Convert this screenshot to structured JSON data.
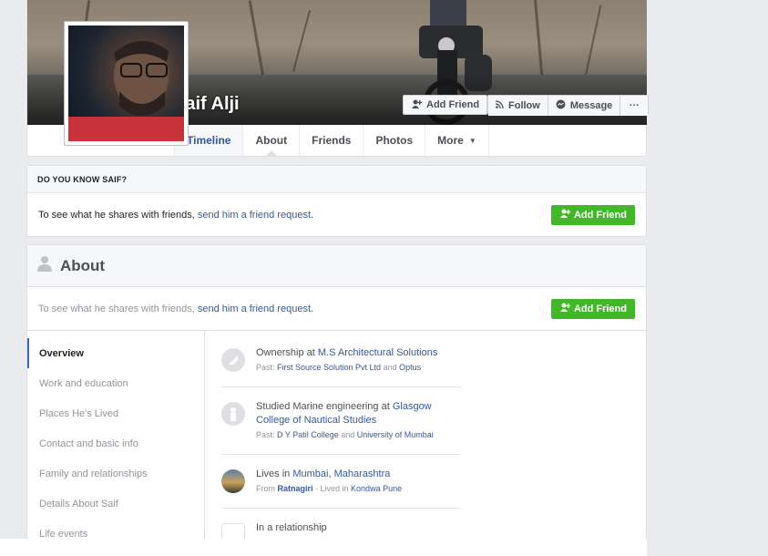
{
  "profile": {
    "name": "Saif Alji",
    "buttons": {
      "add_friend": "Add Friend",
      "follow": "Follow",
      "message": "Message",
      "more_dots": "···"
    }
  },
  "tabs": [
    {
      "label": "Timeline"
    },
    {
      "label": "About"
    },
    {
      "label": "Friends"
    },
    {
      "label": "Photos"
    },
    {
      "label": "More"
    }
  ],
  "know_card": {
    "heading": "DO YOU KNOW SAIF?",
    "text_before": "To see what he shares with friends, ",
    "link": "send him a friend request.",
    "button": "Add Friend"
  },
  "about": {
    "title": "About",
    "share_before": "To see what he shares with friends, ",
    "share_link": "send him a friend request.",
    "button": "Add Friend",
    "nav": [
      "Overview",
      "Work and education",
      "Places He's Lived",
      "Contact and basic info",
      "Family and relationships",
      "Details About Saif",
      "Life events"
    ],
    "entries": [
      {
        "line1_prefix": "Ownership at ",
        "line1_link": "M.S Architectural Solutions",
        "line2_prefix": "Past: ",
        "line2_link1": "First Source Solution Pvt Ltd",
        "line2_mid": " and ",
        "line2_link2": "Optus"
      },
      {
        "line1_prefix": "Studied Marine engineering at ",
        "line1_link": "Glasgow College of Nautical Studies",
        "line2_prefix": "Past: ",
        "line2_link1": "D Y Patil College",
        "line2_mid": " and ",
        "line2_link2": "University of Mumbai"
      },
      {
        "line1_prefix": "Lives in ",
        "line1_link": "Mumbai, Maharashtra",
        "line2_prefix": "From ",
        "line2_link1": "Ratnagiri",
        "line2_mid": " · Lived in ",
        "line2_link2": "Kondwa Pune"
      },
      {
        "line1_prefix": "In a relationship"
      }
    ]
  },
  "colors": {
    "brand_blue": "#4267b2",
    "link": "#365899",
    "green": "#42b72a",
    "page_bg": "#e9ebee"
  }
}
